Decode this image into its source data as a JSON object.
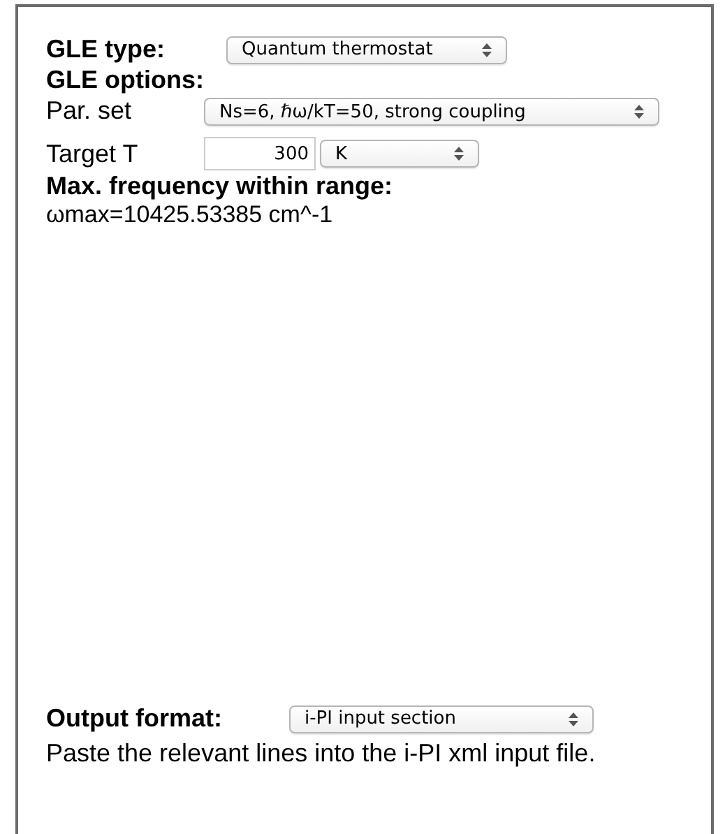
{
  "gle_type": {
    "label": "GLE type:",
    "value": "Quantum thermostat"
  },
  "gle_options": {
    "heading": "GLE options:",
    "par_set": {
      "label": "Par. set",
      "value": "Ns=6, ℏω/kT=50, strong coupling"
    },
    "target_t": {
      "label": "Target T",
      "value": "300",
      "unit": "K"
    }
  },
  "max_frequency": {
    "heading": "Max. frequency within range:",
    "value": "ωmax=10425.53385 cm^-1"
  },
  "output_format": {
    "label": "Output format:",
    "value": "i-PI input section",
    "note": "Paste the relevant lines into the i-PI xml input file."
  }
}
